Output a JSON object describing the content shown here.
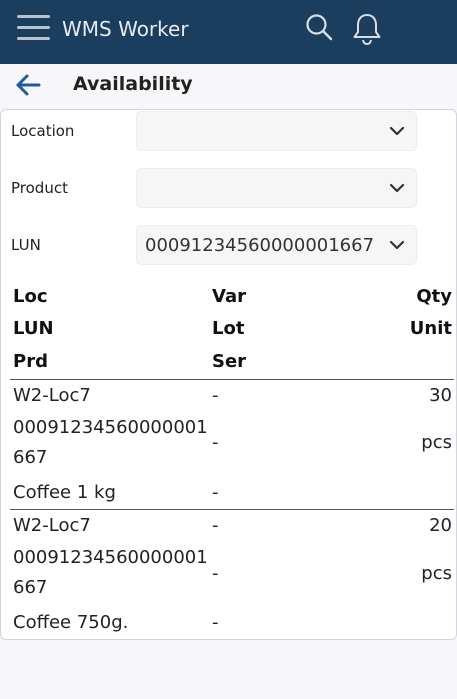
{
  "appbar": {
    "title": "WMS Worker"
  },
  "page": {
    "title": "Availability"
  },
  "filters": {
    "location": {
      "label": "Location",
      "value": ""
    },
    "product": {
      "label": "Product",
      "value": ""
    },
    "lun": {
      "label": "LUN",
      "value": "00091234560000001667"
    }
  },
  "table": {
    "headers": {
      "loc": "Loc",
      "var": "Var",
      "qty": "Qty",
      "lun": "LUN",
      "lot": "Lot",
      "unit": "Unit",
      "prd": "Prd",
      "ser": "Ser"
    },
    "rows": [
      {
        "loc": "W2-Loc7",
        "var": "-",
        "qty": "30",
        "lun_line1": "00091234560000001",
        "lun_line2": "667",
        "lot": "-",
        "unit": "pcs",
        "prd": "Coffee 1 kg",
        "ser": "-"
      },
      {
        "loc": "W2-Loc7",
        "var": "-",
        "qty": "20",
        "lun_line1": "00091234560000001",
        "lun_line2": "667",
        "lot": "-",
        "unit": "pcs",
        "prd": "Coffee 750g.",
        "ser": "-"
      }
    ]
  },
  "colors": {
    "appbar": "#1c3e5e",
    "accent": "#1f5c99"
  }
}
